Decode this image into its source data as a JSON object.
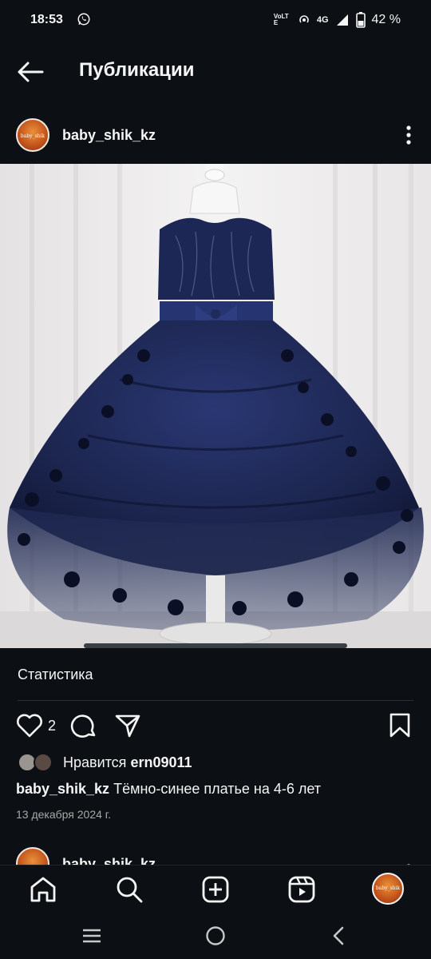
{
  "status_bar": {
    "time": "18:53",
    "volte": "VoLTE",
    "network": "4G",
    "battery": "42 %",
    "icons": [
      "whatsapp-icon",
      "volte-icon",
      "hotspot-icon",
      "signal-icon",
      "battery-icon"
    ]
  },
  "header": {
    "title": "Публикации",
    "back_icon": "arrow-left-icon"
  },
  "post": {
    "username": "baby_shik_kz",
    "avatar_text": "baby_shik",
    "more_icon": "more-vertical-icon",
    "image_description_icon": "photo",
    "stats_label": "Статистика",
    "like_count": "2",
    "likes_prefix": "Нравится",
    "liked_by": "ern09011",
    "caption_user": "baby_shik_kz",
    "caption_text": "Тёмно-синее платье на 4-6 лет",
    "date": "13 декабря 2024 г."
  },
  "next_post": {
    "username": "baby_shik_kz"
  },
  "bottom_nav": {
    "items": [
      "home-icon",
      "search-icon",
      "create-icon",
      "reels-icon",
      "profile-avatar"
    ],
    "profile_avatar_text": "baby_shik"
  },
  "system_nav": {
    "items": [
      "recents-icon",
      "home-circle-icon",
      "back-chevron-icon"
    ]
  },
  "colors": {
    "background": "#0c1014",
    "text": "#f5f5f5",
    "secondary_text": "#a8a8a8",
    "dress": "#1c2650"
  }
}
